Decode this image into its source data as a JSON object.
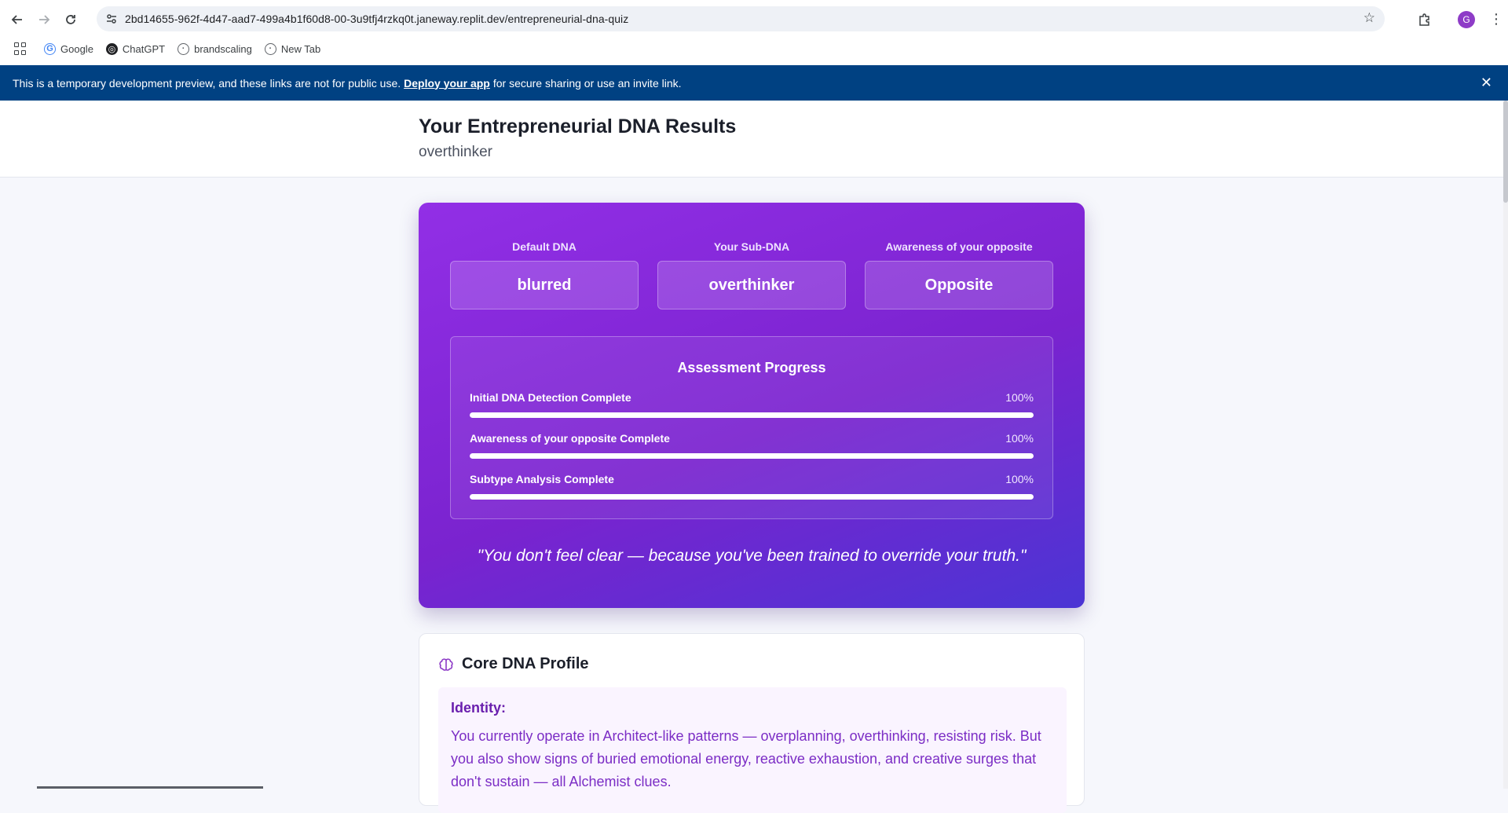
{
  "browser": {
    "url": "2bd14655-962f-4d47-aad7-499a4b1f60d8-00-3u9tfj4rzkq0t.janeway.replit.dev/entrepreneurial-dna-quiz",
    "avatar_initial": "G",
    "bookmarks": [
      {
        "label": "Google"
      },
      {
        "label": "ChatGPT"
      },
      {
        "label": "brandscaling"
      },
      {
        "label": "New Tab"
      }
    ]
  },
  "banner": {
    "text_before": "This is a temporary development preview, and these links are not for public use.",
    "link": "Deploy your app",
    "text_after": "for secure sharing or use an invite link.",
    "close": "✕"
  },
  "header": {
    "title": "Your Entrepreneurial DNA Results",
    "subtitle": "overthinker"
  },
  "hero": {
    "columns": [
      {
        "label": "Default DNA",
        "value": "blurred"
      },
      {
        "label": "Your Sub-DNA",
        "value": "overthinker"
      },
      {
        "label": "Awareness of your opposite",
        "value": "Opposite"
      }
    ],
    "progress": {
      "title": "Assessment Progress",
      "items": [
        {
          "name": "Initial DNA Detection Complete",
          "percent_text": "100%",
          "value": 1.0
        },
        {
          "name": "Awareness of your opposite Complete",
          "percent_text": "100%",
          "value": 1.0
        },
        {
          "name": "Subtype Analysis Complete",
          "percent_text": "100%",
          "value": 1.0
        }
      ]
    },
    "quote": "\"You don't feel clear — because you've been trained to override your truth.\""
  },
  "core": {
    "title": "Core DNA Profile",
    "identity_label": "Identity:",
    "identity_text": "You currently operate in Architect-like patterns — overplanning, overthinking, resisting risk. But you also show signs of buried emotional energy, reactive exhaustion, and creative surges that don't sustain — all Alchemist clues."
  },
  "colors": {
    "banner_bg": "#004182",
    "hero_gradient_start": "#922fe6",
    "hero_gradient_end": "#4b35d4",
    "identity_text": "#7b2dc5"
  }
}
